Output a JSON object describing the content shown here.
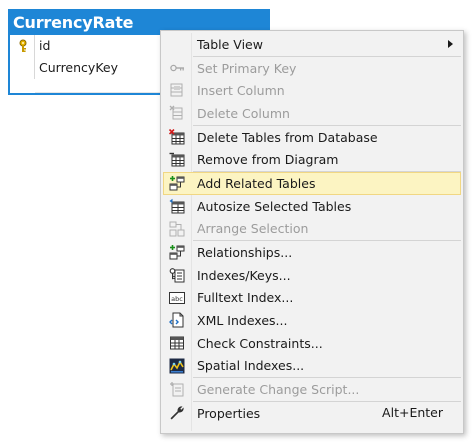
{
  "table": {
    "title": "CurrencyRate",
    "rows": [
      {
        "name": "id",
        "primary_key": true
      },
      {
        "name": "CurrencyKey",
        "primary_key": false
      }
    ]
  },
  "menu": {
    "items": [
      {
        "label": "Table View",
        "submenu": true,
        "disabled": false,
        "icon": "none"
      },
      {
        "separator": true
      },
      {
        "label": "Set Primary Key",
        "disabled": true,
        "icon": "key-icon"
      },
      {
        "label": "Insert Column",
        "disabled": true,
        "icon": "insert-column-icon"
      },
      {
        "label": "Delete Column",
        "disabled": true,
        "icon": "delete-column-icon"
      },
      {
        "separator": true
      },
      {
        "label": "Delete Tables from Database",
        "disabled": false,
        "icon": "delete-table-icon"
      },
      {
        "label": "Remove from Diagram",
        "disabled": false,
        "icon": "remove-diagram-icon"
      },
      {
        "separator": true
      },
      {
        "label": "Add Related Tables",
        "disabled": false,
        "highlighted": true,
        "icon": "related-tables-icon"
      },
      {
        "label": "Autosize Selected Tables",
        "disabled": false,
        "icon": "autosize-icon"
      },
      {
        "label": "Arrange Selection",
        "disabled": true,
        "icon": "arrange-icon"
      },
      {
        "separator": true
      },
      {
        "label": "Relationships...",
        "disabled": false,
        "icon": "relationships-icon"
      },
      {
        "label": "Indexes/Keys...",
        "disabled": false,
        "icon": "indexes-icon"
      },
      {
        "label": "Fulltext Index...",
        "disabled": false,
        "icon": "fulltext-icon"
      },
      {
        "label": "XML Indexes...",
        "disabled": false,
        "icon": "xml-icon"
      },
      {
        "label": "Check Constraints...",
        "disabled": false,
        "icon": "check-constraints-icon"
      },
      {
        "label": "Spatial Indexes...",
        "disabled": false,
        "icon": "spatial-icon"
      },
      {
        "separator": true
      },
      {
        "label": "Generate Change Script...",
        "disabled": true,
        "icon": "script-icon"
      },
      {
        "separator": true
      },
      {
        "label": "Properties",
        "shortcut": "Alt+Enter",
        "disabled": false,
        "icon": "wrench-icon"
      }
    ],
    "fulltext_icon_text": "abc"
  },
  "colors": {
    "table_header": "#1e86d6",
    "menu_background": "#f2f2f2",
    "highlight_background": "#fcf4c2",
    "highlight_border": "#f1d783",
    "disabled_text": "#9c9c9c"
  }
}
